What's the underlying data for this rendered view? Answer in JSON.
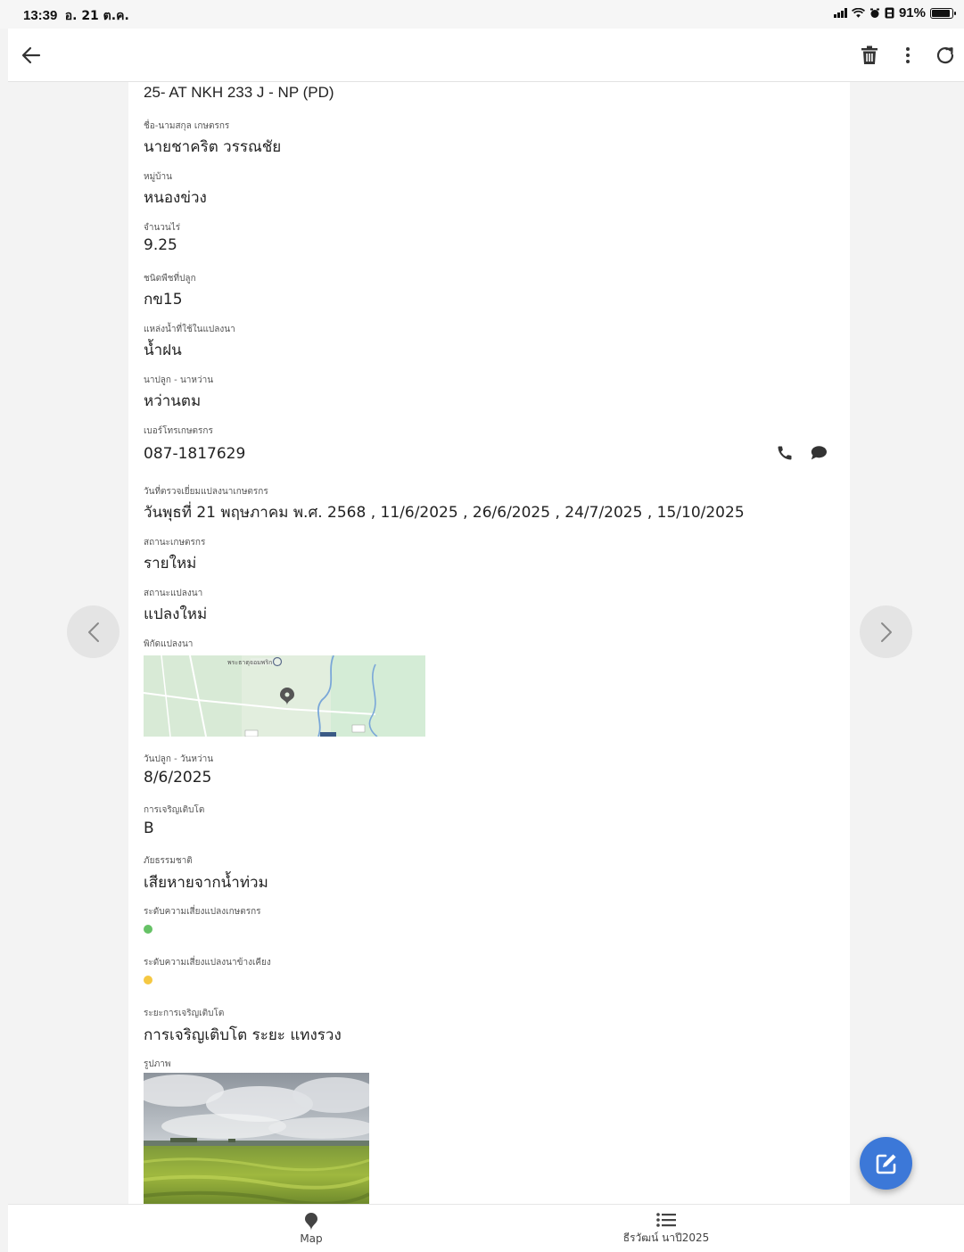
{
  "status_bar": {
    "time": "13:39",
    "date": "อ. 21 ต.ค.",
    "battery_percent": "91%",
    "battery_level": 0.91
  },
  "icons": {
    "back": "arrow-left-icon",
    "delete": "trash-icon",
    "more": "more-vertical-icon",
    "refresh": "refresh-icon",
    "call": "phone-icon",
    "message": "chat-bubble-icon",
    "prev": "chevron-left-icon",
    "next": "chevron-right-icon",
    "edit": "edit-icon",
    "map_tab": "map-pin-icon",
    "list_tab": "list-icon"
  },
  "record": {
    "title": "25- AT NKH 233 J - NP (PD)",
    "farmer_name": {
      "label": "ชื่อ-นามสกุล เกษตรกร",
      "value": "นายชาคริต วรรณชัย"
    },
    "village": {
      "label": "หมู่บ้าน",
      "value": "หนองข่วง"
    },
    "rai": {
      "label": "จำนวนไร่",
      "value": "9.25"
    },
    "crop": {
      "label": "ชนิดพืชที่ปลูก",
      "value": "กข15"
    },
    "water_source": {
      "label": "แหล่งน้ำที่ใช้ในแปลงนา",
      "value": "น้ำฝน"
    },
    "planting_method": {
      "label": "นาปลูก - นาหว่าน",
      "value": "หว่านตม"
    },
    "phone": {
      "label": "เบอร์โทรเกษตรกร",
      "value": "087-1817629"
    },
    "visit_dates": {
      "label": "วันที่ตรวจเยี่ยมแปลงนาเกษตรกร",
      "value": "วันพุธที่ 21 พฤษภาคม พ.ศ. 2568 , 11/6/2025 , 26/6/2025 , 24/7/2025 , 15/10/2025"
    },
    "farmer_status": {
      "label": "สถานะเกษตรกร",
      "value": "รายใหม่"
    },
    "plot_status": {
      "label": "สถานะแปลงนา",
      "value": "แปลงใหม่"
    },
    "plot_location": {
      "label": "พิกัดแปลงนา",
      "map_place": "พระธาตุจอมพริก"
    },
    "planting_date": {
      "label": "วันปลูก - วันหว่าน",
      "value": "8/6/2025"
    },
    "growth": {
      "label": "การเจริญเติบโต",
      "value": "B"
    },
    "disaster": {
      "label": "ภัยธรรมชาติ",
      "value": "เสียหายจากน้ำท่วม"
    },
    "farmer_plot_risk": {
      "label": "ระดับความเสี่ยงแปลงเกษตรกร",
      "color": "#66c266"
    },
    "neighbor_plot_risk": {
      "label": "ระดับความเสี่ยงแปลงนาข้างเคียง",
      "color": "#f5c842"
    },
    "growth_stage": {
      "label": "ระยะการเจริญเติบโต",
      "value": "การเจริญเติบโต ระยะ แทงรวง"
    },
    "photo": {
      "label": "รูปภาพ"
    }
  },
  "bottom_nav": {
    "map_label": "Map",
    "list_label": "ธีรวัฒน์ นาปี2025"
  },
  "colors": {
    "fab": "#3c78d8",
    "nav_circle": "#e4e4e4"
  }
}
